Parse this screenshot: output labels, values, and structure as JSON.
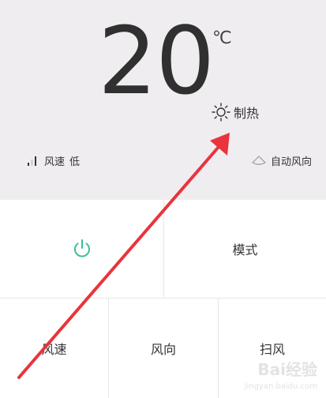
{
  "display": {
    "temperature": "20",
    "unit": "℃",
    "mode_label": "制热",
    "fan_speed_label": "风速",
    "fan_speed_value": "低",
    "swing_label": "自动风向"
  },
  "controls": {
    "power_label": "",
    "mode_button": "模式",
    "fan_speed_button": "风速",
    "direction_button": "风向",
    "swing_button": "扫风"
  },
  "colors": {
    "panel_bg": "#efedf0",
    "power_green": "#3dbf8f",
    "annotation_red": "#e8343c"
  },
  "watermark": {
    "brand": "Bai经验",
    "url": "jingyan.baidu.com"
  }
}
